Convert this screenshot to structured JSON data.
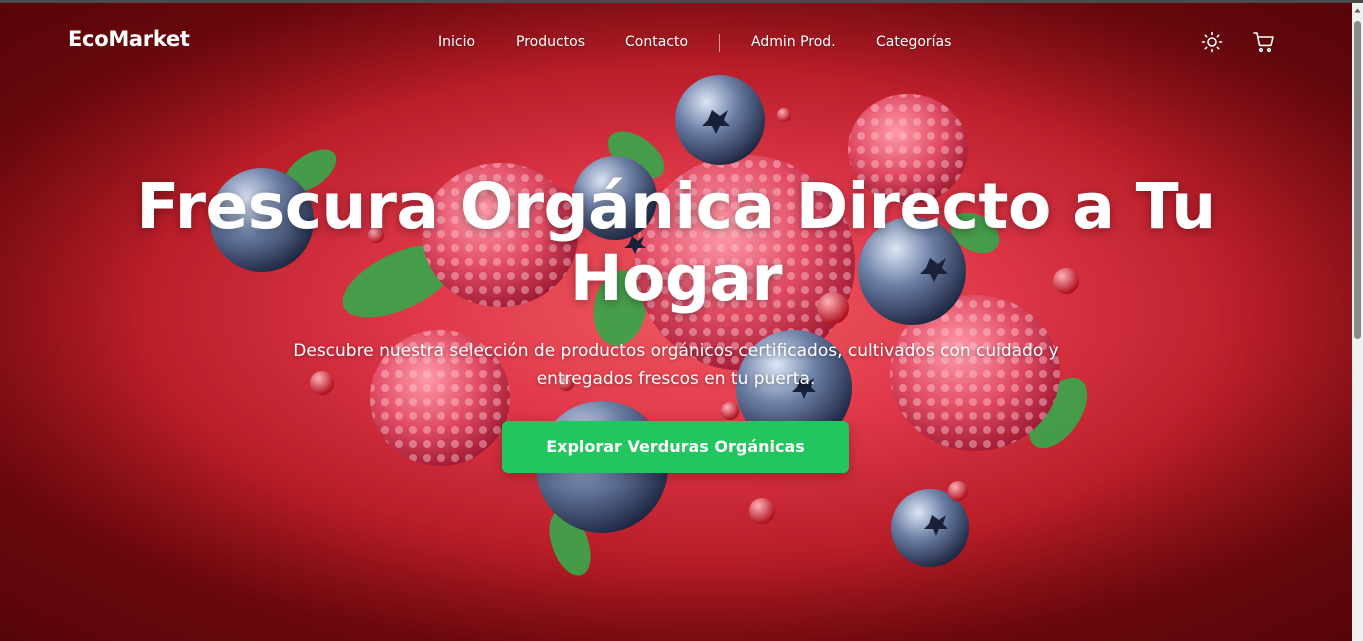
{
  "navbar": {
    "brand": "EcoMarket",
    "links": [
      "Inicio",
      "Productos",
      "Contacto",
      "Admin Prod.",
      "Categorías"
    ],
    "theme_icon": "sun-icon",
    "cart_icon": "cart-icon"
  },
  "hero": {
    "title": "Frescura Orgánica Directo a Tu Hogar",
    "subtitle": "Descubre nuestra selección de productos orgánicos certificados, cultivados con cuidado y entregados frescos en tu puerta.",
    "cta_label": "Explorar Verduras Orgánicas"
  },
  "colors": {
    "accent": "#22c55e",
    "background": "#e0384a",
    "text": "#ffffff"
  }
}
